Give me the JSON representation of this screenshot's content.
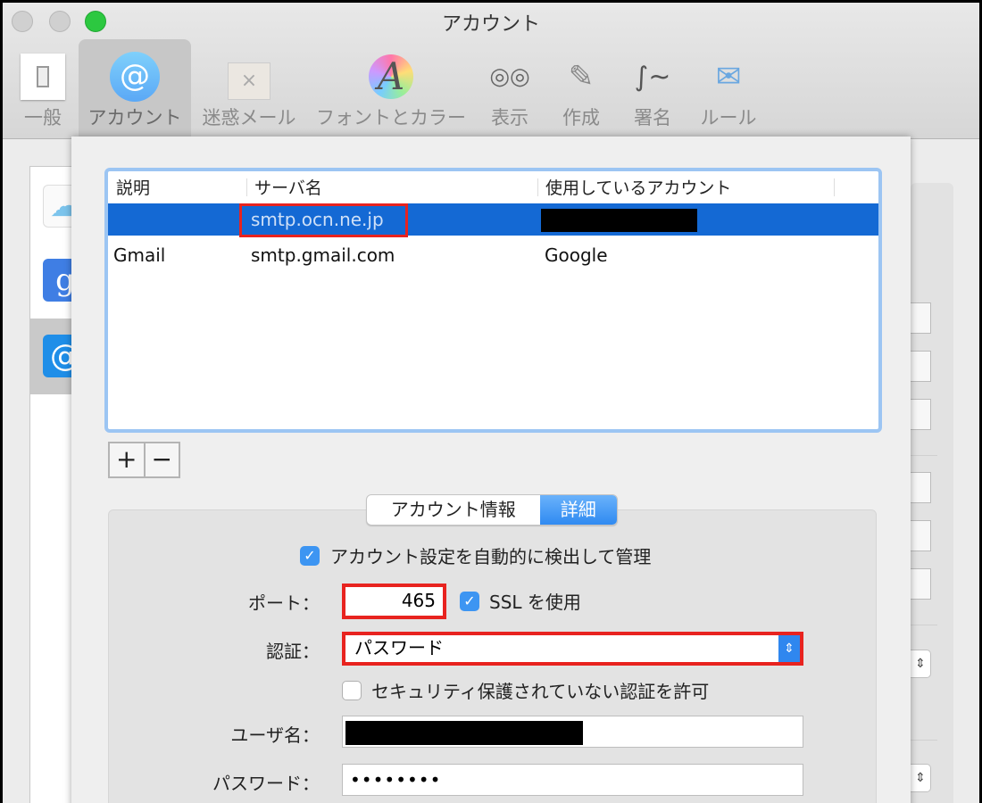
{
  "window": {
    "title": "アカウント"
  },
  "toolbar": {
    "items": [
      {
        "label": "一般",
        "icon": "switch-icon"
      },
      {
        "label": "アカウント",
        "icon": "at-icon",
        "selected": true
      },
      {
        "label": "迷惑メール",
        "icon": "junk-trash-icon"
      },
      {
        "label": "フォントとカラー",
        "icon": "font-color-icon"
      },
      {
        "label": "表示",
        "icon": "glasses-icon"
      },
      {
        "label": "作成",
        "icon": "pencil-icon"
      },
      {
        "label": "署名",
        "icon": "signature-icon"
      },
      {
        "label": "ルール",
        "icon": "rules-envelope-icon"
      }
    ]
  },
  "sidebar": {
    "accounts": [
      {
        "icon": "icloud-icon"
      },
      {
        "icon": "google-icon"
      },
      {
        "icon": "at-icon",
        "selected": true
      }
    ]
  },
  "smtp_table": {
    "headers": [
      "説明",
      "サーバ名",
      "使用しているアカウント"
    ],
    "rows": [
      {
        "description": "",
        "server": "smtp.ocn.ne.jp",
        "account": "[redacted]",
        "selected": true
      },
      {
        "description": "Gmail",
        "server": "smtp.gmail.com",
        "account": "Google"
      }
    ]
  },
  "buttons": {
    "add": "+",
    "remove": "−"
  },
  "tabs": {
    "items": [
      "アカウント情報",
      "詳細"
    ],
    "selected": "詳細"
  },
  "details": {
    "auto_detect_label": "アカウント設定を自動的に検出して管理",
    "auto_detect_checked": true,
    "port_label": "ポート：",
    "port_value": "465",
    "ssl_label": "SSL を使用",
    "ssl_checked": true,
    "auth_label": "認証：",
    "auth_value": "パスワード",
    "insecure_label": "セキュリティ保護されていない認証を許可",
    "insecure_checked": false,
    "username_label": "ユーザ名：",
    "username_value": "[redacted]",
    "password_label": "パスワード：",
    "password_value": "••••••••"
  },
  "colors": {
    "selection": "#1469d4",
    "highlight_box": "#e8231f",
    "checkbox": "#3d95f2"
  }
}
